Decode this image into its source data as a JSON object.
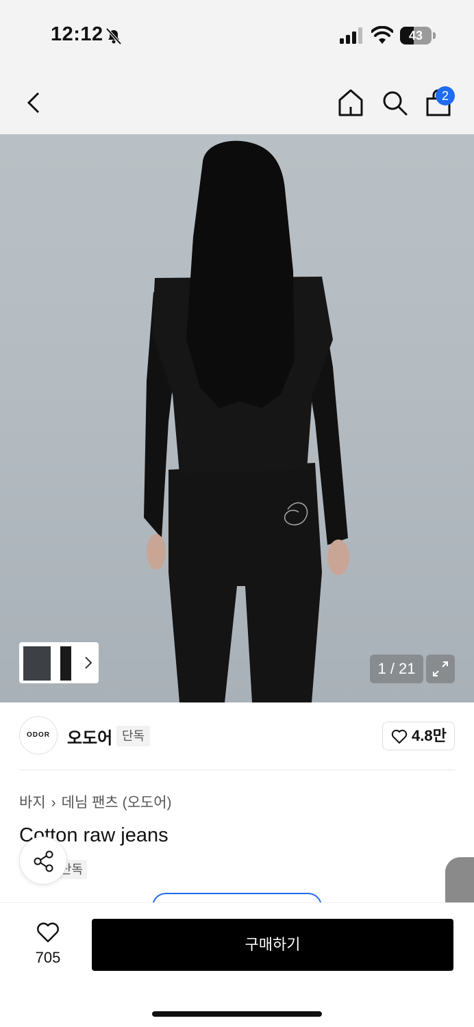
{
  "status": {
    "time": "12:12",
    "battery": "43",
    "battery_level": 0.43
  },
  "nav": {
    "cart_count": "2"
  },
  "hero": {
    "counter": "1 / 21"
  },
  "brand": {
    "logo_text": "ODOR",
    "name": "오도어",
    "tag": "단독",
    "likes": "4.8만"
  },
  "product": {
    "breadcrumb": [
      "바지",
      "데님 팬츠 (오도어)"
    ],
    "title": "Cotton raw jeans",
    "tag": "단독"
  },
  "footer": {
    "wish_count": "705",
    "buy_label": "구매하기"
  },
  "icons": [
    "bell-slash-icon",
    "signal-icon",
    "wifi-icon",
    "battery-icon",
    "back-arrow-icon",
    "home-icon",
    "search-icon",
    "shopping-bag-icon",
    "chevron-right-icon",
    "expand-icon",
    "heart-icon",
    "share-icon"
  ]
}
